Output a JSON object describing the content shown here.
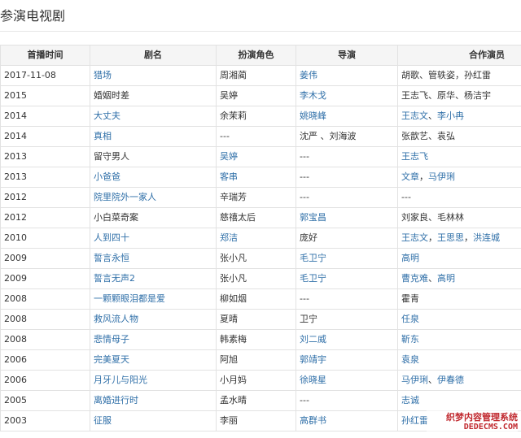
{
  "section": {
    "title": "参演电视剧"
  },
  "table": {
    "headers": [
      "首播时间",
      "剧名",
      "扮演角色",
      "导演",
      "合作演员"
    ],
    "rows": [
      {
        "date": "2017-11-08",
        "title": "猎场",
        "title_link": true,
        "role": "周湘蔺",
        "role_link": false,
        "director": [
          {
            "text": "姜伟",
            "link": true
          }
        ],
        "cast": [
          {
            "text": "胡歌、管轶姿，孙红雷",
            "link": false
          }
        ]
      },
      {
        "date": "2015",
        "title": "婚姻时差",
        "title_link": false,
        "role": "吴婷",
        "role_link": false,
        "director": [
          {
            "text": "李木戈",
            "link": true
          }
        ],
        "cast": [
          {
            "text": "王志飞、原华、杨洁宇",
            "link": false
          }
        ]
      },
      {
        "date": "2014",
        "title": "大丈夫",
        "title_link": true,
        "role": "余茉莉",
        "role_link": false,
        "director": [
          {
            "text": "姚晓峰",
            "link": true
          }
        ],
        "cast": [
          {
            "text": "王志文",
            "link": true
          },
          {
            "text": "、",
            "link": false
          },
          {
            "text": "李小冉",
            "link": true
          }
        ]
      },
      {
        "date": "2014",
        "title": "真相",
        "title_link": true,
        "role": "---",
        "role_link": false,
        "director": [
          {
            "text": "沈严 、刘海波",
            "link": false
          }
        ],
        "cast": [
          {
            "text": "张歆艺、袁弘",
            "link": false
          }
        ]
      },
      {
        "date": "2013",
        "title": "留守男人",
        "title_link": false,
        "role": "吴婷",
        "role_link": true,
        "director": [
          {
            "text": "---",
            "link": false
          }
        ],
        "cast": [
          {
            "text": "王志飞",
            "link": true
          }
        ]
      },
      {
        "date": "2013",
        "title": "小爸爸",
        "title_link": true,
        "role": "客串",
        "role_link": true,
        "director": [
          {
            "text": "---",
            "link": false
          }
        ],
        "cast": [
          {
            "text": "文章",
            "link": true
          },
          {
            "text": "，",
            "link": false
          },
          {
            "text": "马伊琍",
            "link": true
          }
        ]
      },
      {
        "date": "2012",
        "title": "院里院外一家人",
        "title_link": true,
        "role": "辛瑞芳",
        "role_link": false,
        "director": [
          {
            "text": "---",
            "link": false
          }
        ],
        "cast": [
          {
            "text": "---",
            "link": false
          }
        ]
      },
      {
        "date": "2012",
        "title": "小白菜奇案",
        "title_link": false,
        "role": "慈禧太后",
        "role_link": false,
        "director": [
          {
            "text": "郭宝昌",
            "link": true
          }
        ],
        "cast": [
          {
            "text": "刘家良、毛林林",
            "link": false
          }
        ]
      },
      {
        "date": "2010",
        "title": "人到四十",
        "title_link": true,
        "role": "郑洁",
        "role_link": true,
        "director": [
          {
            "text": "庞好",
            "link": false
          }
        ],
        "cast": [
          {
            "text": "王志文",
            "link": true
          },
          {
            "text": "，",
            "link": false
          },
          {
            "text": "王思思",
            "link": true
          },
          {
            "text": "，",
            "link": false
          },
          {
            "text": "洪连城",
            "link": true
          }
        ]
      },
      {
        "date": "2009",
        "title": "誓言永恒",
        "title_link": true,
        "role": "张小凡",
        "role_link": false,
        "director": [
          {
            "text": "毛卫宁",
            "link": true
          }
        ],
        "cast": [
          {
            "text": "高明",
            "link": true
          }
        ]
      },
      {
        "date": "2009",
        "title": "誓言无声2",
        "title_link": true,
        "role": "张小凡",
        "role_link": false,
        "director": [
          {
            "text": "毛卫宁",
            "link": true
          }
        ],
        "cast": [
          {
            "text": "曹克难",
            "link": true
          },
          {
            "text": "、",
            "link": false
          },
          {
            "text": "高明",
            "link": true
          }
        ]
      },
      {
        "date": "2008",
        "title": "一颗颗眼泪都是爱",
        "title_link": true,
        "role": "柳如烟",
        "role_link": false,
        "director": [
          {
            "text": "---",
            "link": false
          }
        ],
        "cast": [
          {
            "text": "霍青",
            "link": false
          }
        ]
      },
      {
        "date": "2008",
        "title": "救风流人物",
        "title_link": true,
        "role": "夏晴",
        "role_link": false,
        "director": [
          {
            "text": "卫宁",
            "link": false
          }
        ],
        "cast": [
          {
            "text": "任泉",
            "link": true
          }
        ]
      },
      {
        "date": "2008",
        "title": "悲情母子",
        "title_link": true,
        "role": "韩素梅",
        "role_link": false,
        "director": [
          {
            "text": "刘二威",
            "link": true
          }
        ],
        "cast": [
          {
            "text": "靳东",
            "link": true
          }
        ]
      },
      {
        "date": "2006",
        "title": "完美夏天",
        "title_link": true,
        "role": "阿旭",
        "role_link": false,
        "director": [
          {
            "text": "郭靖宇",
            "link": true
          }
        ],
        "cast": [
          {
            "text": "袁泉",
            "link": true
          }
        ]
      },
      {
        "date": "2006",
        "title": "月牙儿与阳光",
        "title_link": true,
        "role": "小月妈",
        "role_link": false,
        "director": [
          {
            "text": "徐晓星",
            "link": true
          }
        ],
        "cast": [
          {
            "text": "马伊琍",
            "link": true
          },
          {
            "text": "、",
            "link": false
          },
          {
            "text": "伊春德",
            "link": true
          }
        ]
      },
      {
        "date": "2005",
        "title": "离婚进行时",
        "title_link": true,
        "role": "孟水晴",
        "role_link": false,
        "director": [
          {
            "text": "---",
            "link": false
          }
        ],
        "cast": [
          {
            "text": "志诚",
            "link": true
          }
        ]
      },
      {
        "date": "2003",
        "title": "征服",
        "title_link": true,
        "role": "李丽",
        "role_link": false,
        "director": [
          {
            "text": "高群书",
            "link": true
          }
        ],
        "cast": [
          {
            "text": "孙红雷",
            "link": true
          }
        ]
      }
    ]
  },
  "watermark": {
    "line1": "织梦内容管理系统",
    "line2": "DEDECMS.COM"
  },
  "colors": {
    "link": "#2f6fa8",
    "text": "#333333",
    "header_bg": "#f5f5f5",
    "border": "#e2e2e2",
    "watermark": "#c0282e"
  }
}
